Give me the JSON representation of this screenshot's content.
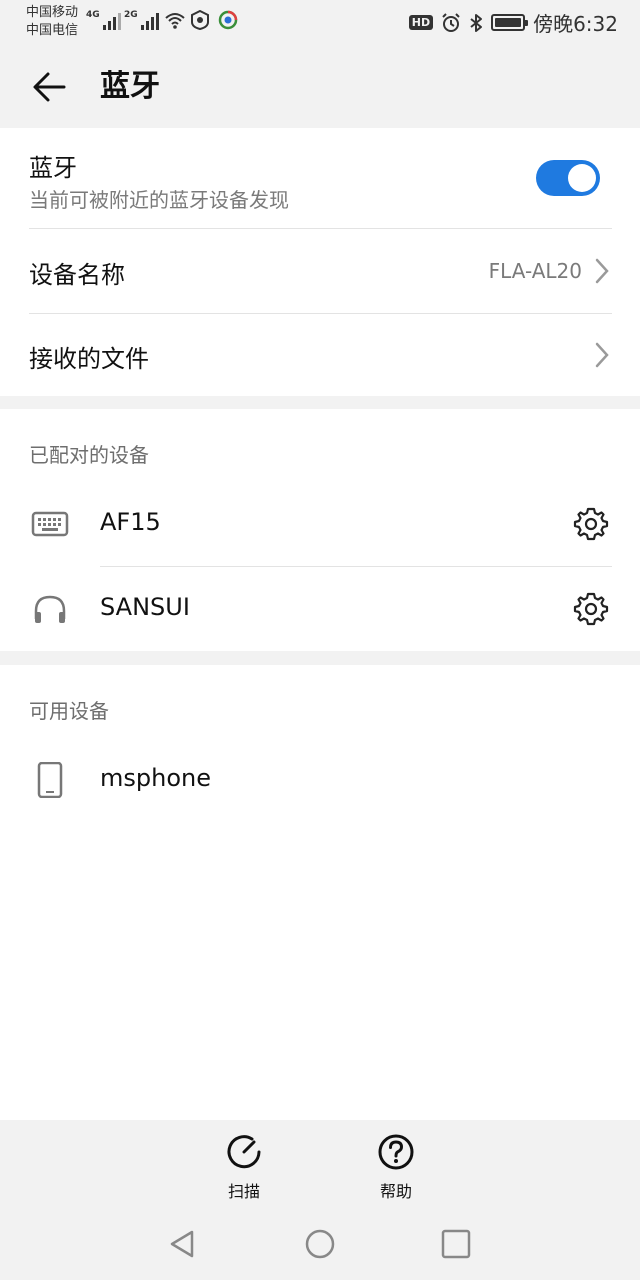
{
  "status_bar": {
    "carrier_1": "中国移动",
    "carrier_2": "中国电信",
    "net_1": "4G",
    "net_2": "2G",
    "hd": "HD",
    "time": "傍晚6:32"
  },
  "header": {
    "title": "蓝牙"
  },
  "bluetooth": {
    "label": "蓝牙",
    "subtitle": "当前可被附近的蓝牙设备发现",
    "enabled": true,
    "accent_color": "#1f7ae0"
  },
  "settings": {
    "device_name_label": "设备名称",
    "device_name_value": "FLA-AL20",
    "received_files_label": "接收的文件"
  },
  "paired": {
    "section_title": "已配对的设备",
    "devices": [
      {
        "name": "AF15",
        "icon": "keyboard-icon"
      },
      {
        "name": "SANSUI",
        "icon": "headphones-icon"
      }
    ]
  },
  "available": {
    "section_title": "可用设备",
    "devices": [
      {
        "name": "msphone",
        "icon": "phone-icon"
      }
    ]
  },
  "actions": {
    "scan_label": "扫描",
    "help_label": "帮助"
  }
}
